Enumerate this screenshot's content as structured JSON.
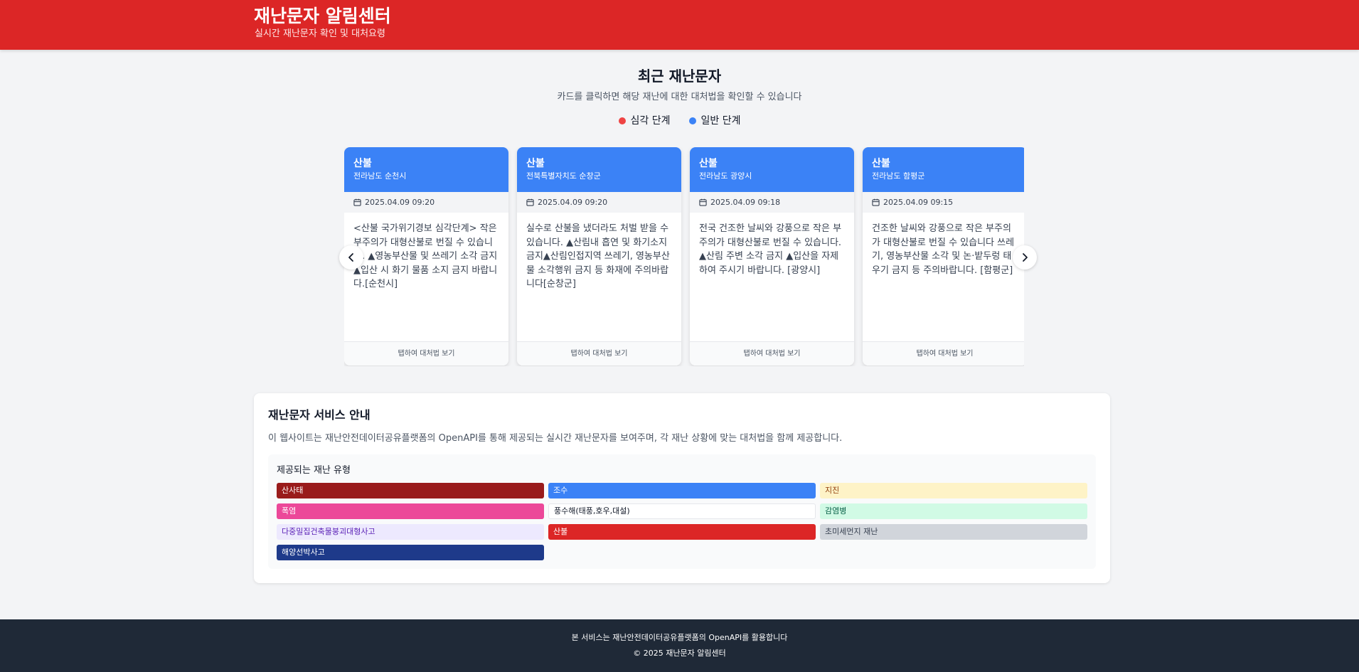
{
  "header": {
    "title": "재난문자 알림센터",
    "subtitle": "실시간 재난문자 확인 및 대처요령",
    "color": "#dc2626"
  },
  "recent": {
    "title": "최근 재난문자",
    "description": "카드를 클릭하면 해당 재난에 대한 대처법을 확인할 수 있습니다",
    "legend": [
      {
        "label": "심각 단계",
        "color": "#ef4444"
      },
      {
        "label": "일반 단계",
        "color": "#3b82f6"
      }
    ],
    "cards": [
      {
        "type": "산불",
        "region": "전라남도 순천시",
        "date": "2025.04.09 09:20",
        "message": "<산불 국가위기경보 심각단계> 작은 부주의가 대형산불로 번질 수 있습니다. ▲영농부산물 및 쓰레기 소각 금지 ▲입산 시 화기 물품 소지 금지 바랍니다.[순천시]",
        "footer": "탭하여 대처법 보기"
      },
      {
        "type": "산불",
        "region": "전북특별자치도 순창군",
        "date": "2025.04.09 09:20",
        "message": "실수로 산불을 냈더라도 처벌 받을 수 있습니다. ▲산림내 흡연 및 화기소지 금지▲산림인접지역 쓰레기, 영농부산물 소각행위 금지 등 화재에 주의바랍니다[순창군]",
        "footer": "탭하여 대처법 보기"
      },
      {
        "type": "산불",
        "region": "전라남도 광양시",
        "date": "2025.04.09 09:18",
        "message": "전국 건조한 날씨와 강풍으로 작은 부주의가 대형산불로 번질 수 있습니다. ▲산림 주변 소각 금지 ▲입산을 자제하여 주시기 바랍니다. [광양시]",
        "footer": "탭하여 대처법 보기"
      },
      {
        "type": "산불",
        "region": "전라남도 함평군",
        "date": "2025.04.09 09:15",
        "message": "건조한 날씨와 강풍으로 작은 부주의가 대형산불로 번질 수 있습니다 쓰레기, 영농부산물 소각 및 논·밭두렁 태우기 금지 등 주의바랍니다. [함평군]",
        "footer": "탭하여 대처법 보기"
      }
    ],
    "card_header_color": "#3b82f6"
  },
  "info": {
    "title": "재난문자 서비스 안내",
    "description": "이 웹사이트는 재난안전데이터공유플랫폼의 OpenAPI를 통해 제공되는 실시간 재난문자를 보여주며, 각 재난 상황에 맞는 대처법을 함께 제공합니다.",
    "types_title": "제공되는 재난 유형",
    "types": [
      {
        "label": "산사태",
        "bg": "#991b1b",
        "fg": "#ffffff"
      },
      {
        "label": "조수",
        "bg": "#3b82f6",
        "fg": "#ffffff"
      },
      {
        "label": "지진",
        "bg": "#fef3c7",
        "fg": "#92400e"
      },
      {
        "label": "폭염",
        "bg": "#ec4899",
        "fg": "#ffffff"
      },
      {
        "label": "풍수해(태풍,호우,대설)",
        "bg": "#ffffff",
        "fg": "#111827"
      },
      {
        "label": "감염병",
        "bg": "#d1fae5",
        "fg": "#065f46"
      },
      {
        "label": "다중밀집건축물붕괴대형사고",
        "bg": "#ede9fe",
        "fg": "#5b21b6"
      },
      {
        "label": "산불",
        "bg": "#dc2626",
        "fg": "#ffffff"
      },
      {
        "label": "초미세먼지 재난",
        "bg": "#d1d5db",
        "fg": "#374151"
      },
      {
        "label": "해양선박사고",
        "bg": "#1e3a8a",
        "fg": "#ffffff"
      }
    ]
  },
  "footer": {
    "line1": "본 서비스는 재난안전데이터공유플랫폼의 OpenAPI를 활용합니다",
    "line2": "© 2025 재난문자 알림센터"
  },
  "icons": {
    "calendar": "calendar-icon",
    "prev": "chevron-left-icon",
    "next": "chevron-right-icon"
  }
}
